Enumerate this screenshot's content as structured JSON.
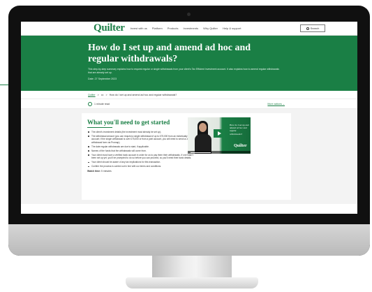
{
  "header": {
    "logo": "Quilter",
    "nav": [
      "Invest with us",
      "Platform",
      "Products",
      "Investments",
      "Why Quilter",
      "Help & support"
    ],
    "search_label": "Search"
  },
  "hero": {
    "title": "How do I set up and amend ad hoc and regular withdrawals?",
    "description": "This step-by-step summary explains how to request regular or single withdrawals from your client's Tax Efficient Investment account. It also explains how to amend regular withdrawals that are already set up.",
    "date": "Date: 27 September 2023"
  },
  "breadcrumb": {
    "home": "Quilter",
    "ellipsis": "•••",
    "current": "How do I set up and amend ad hoc and regular withdrawals?"
  },
  "reading": {
    "time": "1 minute read",
    "more_actions": "More actions"
  },
  "content": {
    "title": "What you'll need to get started",
    "bullets": [
      "The client's investment details (the investment must already be set up).",
      "The withdrawal amount (you can request a single withdrawal of up to £75,000 from an individually held account; if the single withdrawal is over £75,000 or from a joint account, you will need to send us a withdrawal form via Promap).",
      "The date regular withdrawals are due to start, if applicable.",
      "Names of the funds that the withdrawals will come from.",
      "Your client must have a verified bank account in order for us to pay them their withdrawals. If one hasn't been set up yet, you'll be prompted to do so before you can proceed, so you'll need their bank details.",
      "Your client should be aware of any tax implications for this transaction.",
      "Confirm the process is carried out in line with our terms and conditions."
    ],
    "watch_label": "Watch time:",
    "watch_value": "5 minutes"
  },
  "video": {
    "overlay_text": "How do I set up and amend ad hoc and regular withdrawals?",
    "logo": "Quilter",
    "progress": 0.35
  },
  "colors": {
    "brand_green": "#1a7f45"
  }
}
